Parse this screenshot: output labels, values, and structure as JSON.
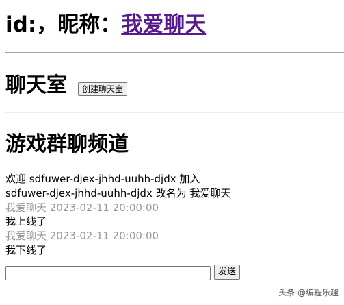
{
  "header": {
    "id_label": "id:，",
    "nickname_label": "昵称：",
    "nickname_link": "我爱聊天"
  },
  "chatroom": {
    "title": "聊天室",
    "create_button": "创建聊天室"
  },
  "channel": {
    "title": "游戏群聊频道",
    "messages": [
      {
        "text": "欢迎 sdfuwer-djex-jhhd-uuhh-djdx 加入"
      },
      {
        "text": "sdfuwer-djex-jhhd-uuhh-djdx 改名为 我爱聊天"
      },
      {
        "meta": "我爱聊天 2023-02-11 20:00:00",
        "text": "我上线了"
      },
      {
        "meta": "我爱聊天 2023-02-11 20:00:00",
        "text": "我下线了"
      }
    ],
    "input_value": "",
    "send_button": "发送"
  },
  "watermark": "头条 @编程乐趣"
}
